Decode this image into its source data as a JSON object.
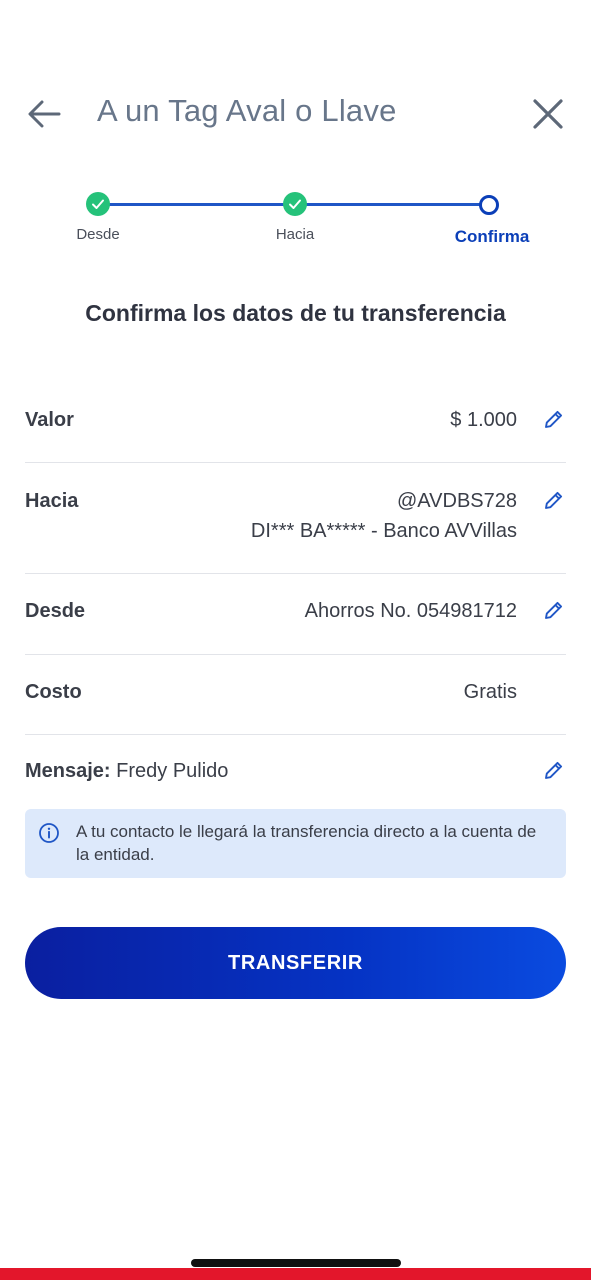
{
  "header": {
    "title": "A un Tag Aval o Llave"
  },
  "stepper": {
    "steps": [
      {
        "label": "Desde",
        "state": "done"
      },
      {
        "label": "Hacia",
        "state": "done"
      },
      {
        "label": "Confirma",
        "state": "current"
      }
    ]
  },
  "heading": "Confirma los datos de tu transferencia",
  "rows": {
    "valor": {
      "label": "Valor",
      "value": "$ 1.000"
    },
    "hacia": {
      "label": "Hacia",
      "value": "@AVDBS728",
      "value2": "DI*** BA***** - Banco AVVillas"
    },
    "desde": {
      "label": "Desde",
      "value": "Ahorros No. 054981712"
    },
    "costo": {
      "label": "Costo",
      "value": "Gratis"
    }
  },
  "message": {
    "label": "Mensaje:",
    "value": "Fredy Pulido"
  },
  "info": {
    "text": "A tu contacto le llegará la transferencia directo a la cuenta de la entidad."
  },
  "cta": {
    "label": "TRANSFERIR"
  },
  "colors": {
    "primary": "#0b3fb8",
    "success": "#25c27a",
    "info_bg": "#dde9fb",
    "brand_red": "#e3162b"
  },
  "icons": [
    "back-arrow-icon",
    "close-icon",
    "check-icon",
    "edit-pencil-icon",
    "info-icon"
  ]
}
